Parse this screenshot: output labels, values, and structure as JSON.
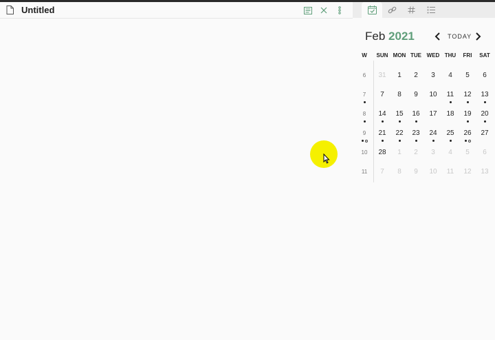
{
  "editor": {
    "title": "Untitled",
    "header_actions": [
      {
        "icon": "reading-view-icon"
      },
      {
        "icon": "close-icon"
      },
      {
        "icon": "more-options-icon"
      }
    ]
  },
  "sidebar": {
    "tabs": [
      {
        "icon": "calendar-check-icon",
        "active": true
      },
      {
        "icon": "link-icon",
        "active": false
      },
      {
        "icon": "hash-icon",
        "active": false
      },
      {
        "icon": "list-icon",
        "active": false
      }
    ],
    "calendar": {
      "month": "Feb",
      "year": "2021",
      "today_label": "TODAY",
      "headers": [
        "W",
        "SUN",
        "MON",
        "TUE",
        "WED",
        "THU",
        "FRI",
        "SAT"
      ],
      "weeks": [
        {
          "week": "6",
          "week_dots": [],
          "days": [
            {
              "d": "31",
              "dim": true,
              "dots": []
            },
            {
              "d": "1",
              "dim": false,
              "dots": []
            },
            {
              "d": "2",
              "dim": false,
              "dots": []
            },
            {
              "d": "3",
              "dim": false,
              "dots": []
            },
            {
              "d": "4",
              "dim": false,
              "dots": []
            },
            {
              "d": "5",
              "dim": false,
              "dots": []
            },
            {
              "d": "6",
              "dim": false,
              "dots": []
            }
          ]
        },
        {
          "week": "7",
          "week_dots": [
            "filled"
          ],
          "days": [
            {
              "d": "7",
              "dim": false,
              "dots": []
            },
            {
              "d": "8",
              "dim": false,
              "dots": []
            },
            {
              "d": "9",
              "dim": false,
              "dots": []
            },
            {
              "d": "10",
              "dim": false,
              "dots": []
            },
            {
              "d": "11",
              "dim": false,
              "dots": [
                "filled"
              ]
            },
            {
              "d": "12",
              "dim": false,
              "dots": [
                "filled"
              ]
            },
            {
              "d": "13",
              "dim": false,
              "dots": [
                "filled"
              ]
            }
          ]
        },
        {
          "week": "8",
          "week_dots": [
            "filled"
          ],
          "days": [
            {
              "d": "14",
              "dim": false,
              "dots": [
                "filled"
              ]
            },
            {
              "d": "15",
              "dim": false,
              "dots": [
                "filled"
              ]
            },
            {
              "d": "16",
              "dim": false,
              "dots": [
                "filled"
              ]
            },
            {
              "d": "17",
              "dim": false,
              "dots": []
            },
            {
              "d": "18",
              "dim": false,
              "dots": []
            },
            {
              "d": "19",
              "dim": false,
              "dots": [
                "filled"
              ]
            },
            {
              "d": "20",
              "dim": false,
              "dots": [
                "filled"
              ]
            }
          ]
        },
        {
          "week": "9",
          "week_dots": [
            "filled",
            "hollow"
          ],
          "days": [
            {
              "d": "21",
              "dim": false,
              "dots": [
                "filled"
              ]
            },
            {
              "d": "22",
              "dim": false,
              "dots": [
                "filled"
              ]
            },
            {
              "d": "23",
              "dim": false,
              "dots": [
                "filled"
              ]
            },
            {
              "d": "24",
              "dim": false,
              "dots": [
                "filled"
              ]
            },
            {
              "d": "25",
              "dim": false,
              "dots": [
                "filled"
              ]
            },
            {
              "d": "26",
              "dim": false,
              "dots": [
                "filled",
                "hollow"
              ]
            },
            {
              "d": "27",
              "dim": false,
              "dots": []
            }
          ]
        },
        {
          "week": "10",
          "week_dots": [],
          "days": [
            {
              "d": "28",
              "dim": false,
              "dots": []
            },
            {
              "d": "1",
              "dim": true,
              "dots": []
            },
            {
              "d": "2",
              "dim": true,
              "dots": []
            },
            {
              "d": "3",
              "dim": true,
              "dots": []
            },
            {
              "d": "4",
              "dim": true,
              "dots": []
            },
            {
              "d": "5",
              "dim": true,
              "dots": []
            },
            {
              "d": "6",
              "dim": true,
              "dots": []
            }
          ]
        },
        {
          "week": "11",
          "week_dots": [],
          "days": [
            {
              "d": "7",
              "dim": true,
              "dots": []
            },
            {
              "d": "8",
              "dim": true,
              "dots": []
            },
            {
              "d": "9",
              "dim": true,
              "dots": []
            },
            {
              "d": "10",
              "dim": true,
              "dots": []
            },
            {
              "d": "11",
              "dim": true,
              "dots": []
            },
            {
              "d": "12",
              "dim": true,
              "dots": []
            },
            {
              "d": "13",
              "dim": true,
              "dots": []
            }
          ]
        }
      ]
    }
  },
  "colors": {
    "accent": "#5f9e7a",
    "cursor_highlight": "#f5f000"
  }
}
